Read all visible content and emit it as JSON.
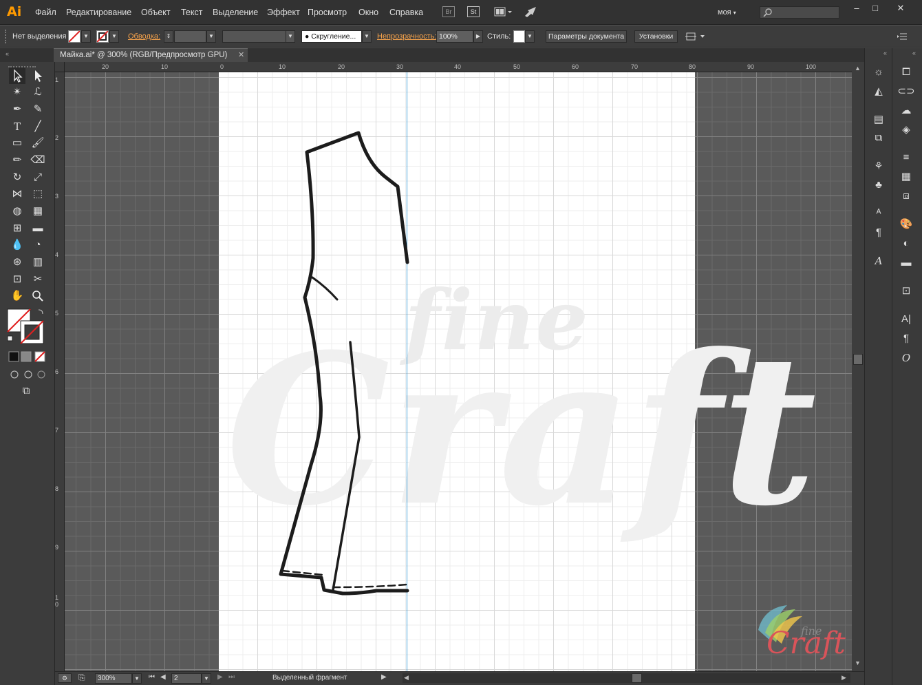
{
  "app": {
    "logo": "Ai"
  },
  "menu": [
    "Файл",
    "Редактирование",
    "Объект",
    "Текст",
    "Выделение",
    "Эффект",
    "Просмотр",
    "Окно",
    "Справка"
  ],
  "topbar": {
    "bridge": "Br",
    "stock": "St",
    "workspace": "моя"
  },
  "window_controls": {
    "minimize": "–",
    "maximize": "□",
    "close": "✕"
  },
  "control_bar": {
    "selection_label": "Нет выделения",
    "stroke_label": "Обводка:",
    "brush_value": "Скругление...",
    "opacity_label": "Непрозрачность:",
    "opacity_value": "100%",
    "style_label": "Стиль:",
    "doc_setup_button": "Параметры документа",
    "preferences_button": "Установки"
  },
  "document_tab": {
    "title": "Майка.ai* @ 300% (RGB/Предпросмотр GPU)",
    "close": "✕"
  },
  "ruler": {
    "horizontal": [
      "20",
      "10",
      "0",
      "10",
      "20",
      "30",
      "40",
      "50",
      "60",
      "70",
      "80",
      "90",
      "100"
    ],
    "vertical": [
      "1",
      "2",
      "3",
      "4",
      "5",
      "6",
      "7",
      "8",
      "9",
      "10"
    ]
  },
  "watermark": {
    "line1": "fine",
    "line2": "Craft"
  },
  "logo_badge": {
    "small": "fine",
    "big": "Craft"
  },
  "status_bar": {
    "zoom": "300%",
    "artboard": "2",
    "info": "Выделенный фрагмент"
  },
  "colors": {
    "accent_orange": "#ff9a00",
    "link_orange": "#f7a34b",
    "guide_blue": "#4aa3d8",
    "badge_red": "#d9545a"
  }
}
